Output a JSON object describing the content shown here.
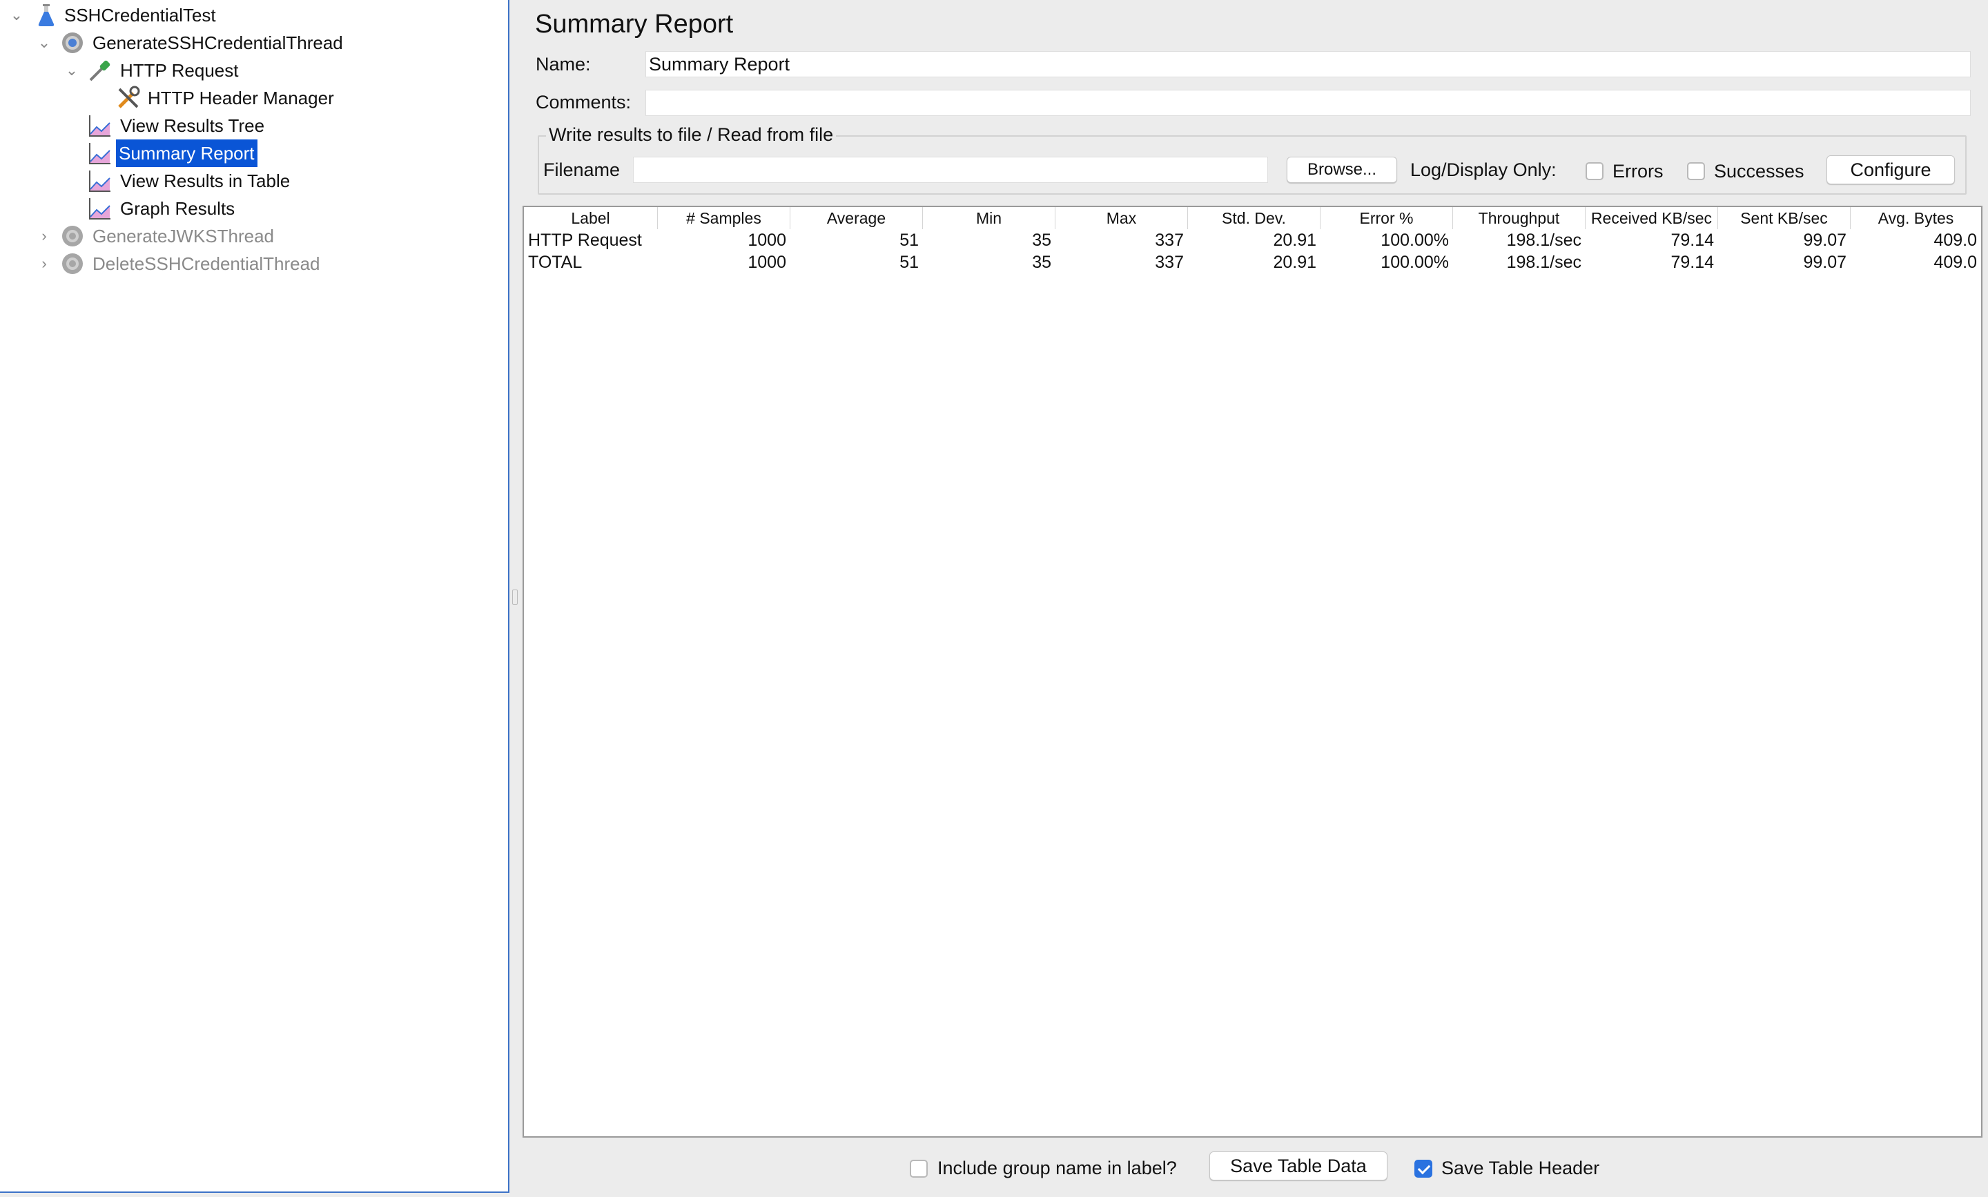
{
  "tree": {
    "items": [
      {
        "label": "SSHCredentialTest",
        "icon": "flask-icon",
        "expanded": true
      },
      {
        "label": "GenerateSSHCredentialThread",
        "icon": "gear-icon",
        "expanded": true
      },
      {
        "label": "HTTP Request",
        "icon": "pipette-icon",
        "expanded": true
      },
      {
        "label": "HTTP Header Manager",
        "icon": "tools-icon"
      },
      {
        "label": "View Results Tree",
        "icon": "chart-icon"
      },
      {
        "label": "Summary Report",
        "icon": "chart-icon",
        "selected": true
      },
      {
        "label": "View Results in Table",
        "icon": "chart-icon"
      },
      {
        "label": "Graph Results",
        "icon": "chart-icon"
      },
      {
        "label": "GenerateJWKSThread",
        "icon": "gear-icon",
        "expanded": false,
        "disabled": true
      },
      {
        "label": "DeleteSSHCredentialThread",
        "icon": "gear-icon",
        "expanded": false,
        "disabled": true
      }
    ]
  },
  "panel": {
    "title": "Summary Report",
    "name_label": "Name:",
    "name_value": "Summary Report",
    "comments_label": "Comments:",
    "comments_value": ""
  },
  "file_section": {
    "legend": "Write results to file / Read from file",
    "filename_label": "Filename",
    "filename_value": "",
    "browse_label": "Browse...",
    "log_display_label": "Log/Display Only:",
    "errors_label": "Errors",
    "errors_checked": false,
    "successes_label": "Successes",
    "successes_checked": false,
    "configure_label": "Configure"
  },
  "table": {
    "headers": [
      "Label",
      "# Samples",
      "Average",
      "Min",
      "Max",
      "Std. Dev.",
      "Error %",
      "Throughput",
      "Received KB/sec",
      "Sent KB/sec",
      "Avg. Bytes"
    ],
    "rows": [
      [
        "HTTP Request",
        "1000",
        "51",
        "35",
        "337",
        "20.91",
        "100.00%",
        "198.1/sec",
        "79.14",
        "99.07",
        "409.0"
      ],
      [
        "TOTAL",
        "1000",
        "51",
        "35",
        "337",
        "20.91",
        "100.00%",
        "198.1/sec",
        "79.14",
        "99.07",
        "409.0"
      ]
    ]
  },
  "footer": {
    "include_group_label": "Include group name in label?",
    "include_group_checked": false,
    "save_data_label": "Save Table Data",
    "save_header_label": "Save Table Header",
    "save_header_checked": true
  },
  "colors": {
    "selection": "#0a55d6",
    "accent": "#2a72e0",
    "background": "#ececec"
  }
}
